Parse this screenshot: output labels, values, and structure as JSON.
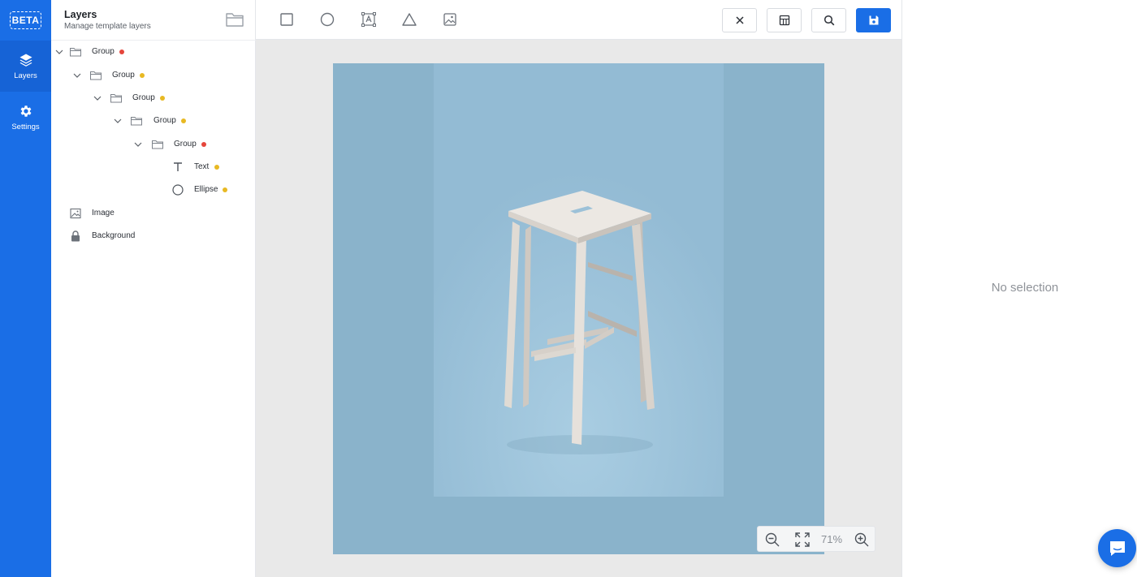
{
  "app": {
    "badge": "BETA",
    "accent_color": "#1a6ee6"
  },
  "nav": {
    "items": [
      {
        "label": "Layers",
        "icon": "layers-icon",
        "active": true
      },
      {
        "label": "Settings",
        "icon": "gear-icon",
        "active": false
      }
    ]
  },
  "layers_panel": {
    "title": "Layers",
    "subtitle": "Manage template layers",
    "layers": [
      {
        "name": "Group",
        "type": "group",
        "depth": 0,
        "expanded": true,
        "dot_color": "#e5453b"
      },
      {
        "name": "Group",
        "type": "group",
        "depth": 1,
        "expanded": true,
        "dot_color": "#e8b923"
      },
      {
        "name": "Group",
        "type": "group",
        "depth": 2,
        "expanded": true,
        "dot_color": "#e8b923"
      },
      {
        "name": "Group",
        "type": "group",
        "depth": 3,
        "expanded": true,
        "dot_color": "#e8b923"
      },
      {
        "name": "Group",
        "type": "group",
        "depth": 4,
        "expanded": true,
        "dot_color": "#e5453b"
      },
      {
        "name": "Text",
        "type": "text",
        "depth": 5,
        "dot_color": "#e8b923"
      },
      {
        "name": "Ellipse",
        "type": "ellipse",
        "depth": 5,
        "dot_color": "#e8b923"
      },
      {
        "name": "Image",
        "type": "image",
        "depth": 0
      },
      {
        "name": "Background",
        "type": "background",
        "depth": 0,
        "locked": true
      }
    ]
  },
  "toolbar": {
    "tools": [
      "rectangle-tool-icon",
      "ellipse-tool-icon",
      "text-tool-icon",
      "triangle-tool-icon",
      "image-tool-icon"
    ],
    "actions": [
      "close-icon",
      "table-icon",
      "search-icon",
      "save-icon"
    ]
  },
  "canvas": {
    "zoom": "71%"
  },
  "properties": {
    "empty_text": "No selection"
  }
}
